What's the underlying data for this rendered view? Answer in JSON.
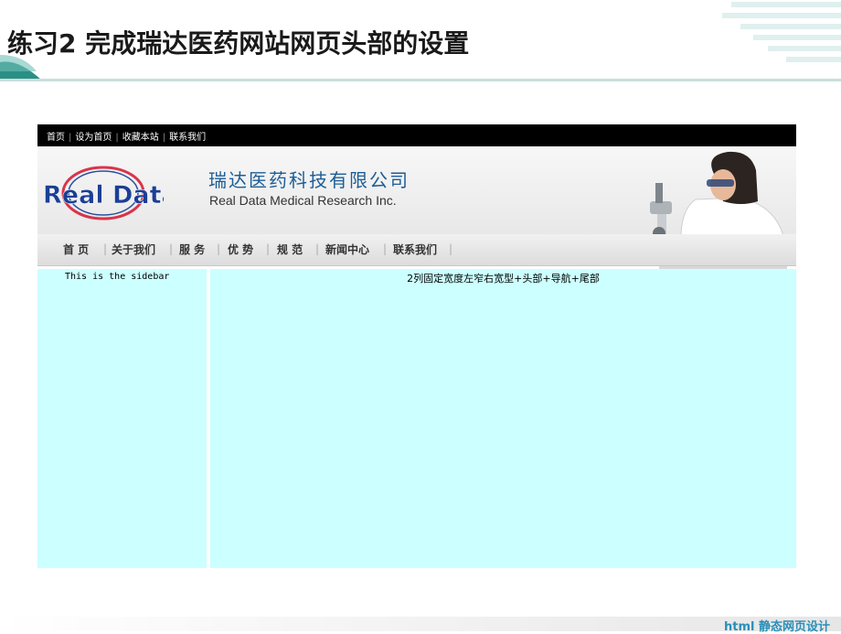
{
  "slide": {
    "title": "练习2  完成瑞达医药网站网页头部的设置",
    "footer": "html 静态网页设计"
  },
  "site": {
    "top_links": [
      "首页",
      "设为首页",
      "收藏本站",
      "联系我们"
    ],
    "logo_text": "Real Data",
    "company_name_cn": "瑞达医药科技有限公司",
    "company_name_en": "Real Data Medical Research Inc.",
    "nav": [
      "首 页",
      "关于我们",
      "服 务",
      "优 势",
      "规 范",
      "新闻中心",
      "联系我们"
    ],
    "sidebar_text": "This is the sidebar",
    "main_text": "2列固定宽度左窄右宽型+头部+导航+尾部"
  },
  "colors": {
    "content_bg": "#ccffff",
    "topbar_bg": "#000000",
    "company_blue": "#1c5d97",
    "footer_blue": "#2a8fb8"
  }
}
